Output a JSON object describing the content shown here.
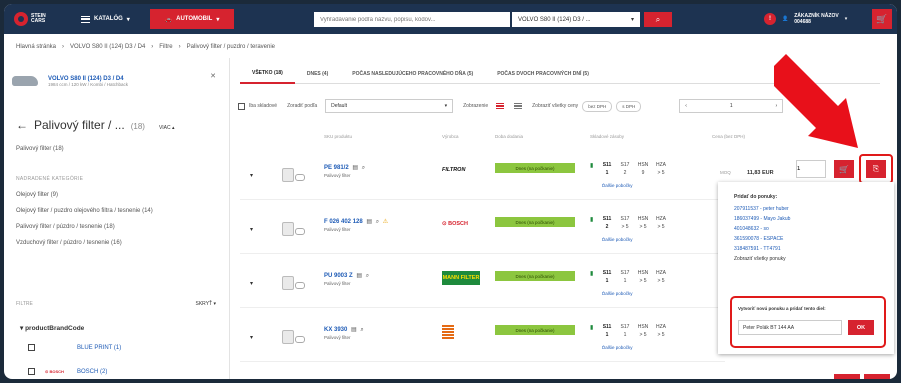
{
  "header": {
    "logo_line1": "STEIN",
    "logo_line2": "CARS",
    "catalog": "KATALÓG",
    "automobil": "AUTOMOBIL",
    "search_placeholder": "Vyhľadávanie podľa názvu, popisu, kódov...",
    "vehicle": "VOLVO S80 II (124) D3 / ...",
    "user_line1": "ZÁKAZNÍK NÁZOV",
    "user_line2": "004688",
    "badge": "!"
  },
  "breadcrumb": [
    "Hlavná stránka",
    "VOLVO S80 II (124) D3 / D4",
    "Filtre",
    "Palivový filter / puzdro / teravenie"
  ],
  "vehicle": {
    "name": "VOLVO S80 II (124) D3 / D4",
    "sub": "1984 ccm / 120 kW / Kombi / Hatchback"
  },
  "category": {
    "title": "Palivový filter / ...",
    "count": "(18)",
    "more": "VIAC",
    "sub": "Palivový filter (18)"
  },
  "related": {
    "head": "NADRADENÉ KATEGÓRIE",
    "items": [
      "Olejový filter (9)",
      "Olejový filter / puzdro olejového filtra / tesnenie (14)",
      "Palivový filter / púzdro / tesnenie (18)",
      "Vzduchový filter / púzdro / tesnenie (16)"
    ]
  },
  "filters": {
    "head": "FILTRE",
    "hide": "SKRYŤ",
    "group": "productBrandCode",
    "brands": [
      "BLUE PRINT (1)",
      "BOSCH (2)"
    ]
  },
  "tabs": [
    "VŠETKO (18)",
    "DNES (4)",
    "POČAS NASLEDUJÚCEHO PRACOVNÉHO DŇA (5)",
    "POČAS DVOCH PRACOVNÝCH DNÍ (5)"
  ],
  "toolbar": {
    "only_stock": "Iba skladové",
    "sort_label": "Zoradiť podľa",
    "sort_value": "Default",
    "view_label": "Zobrazenie",
    "show_all": "Zobraziť všetky ceny",
    "price_with": "bez DPH",
    "price_without": "s DPH",
    "page": "1"
  },
  "columns": {
    "code": "SKU produktu",
    "brand": "Výrobca",
    "delivery": "Doba dodania",
    "stock": "Skladové zásoby",
    "price": "Cena (bez DPH)"
  },
  "products": [
    {
      "code": "PE 981/2",
      "desc": "Palivový filter",
      "brand": "FILTRON",
      "avail": "Dnes (na počkanie)",
      "stock_head": [
        "S11",
        "S17",
        "HSN",
        "HZA"
      ],
      "stock_vals": [
        "1",
        "2",
        "9",
        "> 5"
      ]
    },
    {
      "code": "F 026 402 128",
      "desc": "Palivový filter",
      "brand": "BOSCH",
      "avail": "Dnes (na počkanie)",
      "stock_head": [
        "S11",
        "S17",
        "HSN",
        "HZA"
      ],
      "stock_vals": [
        "2",
        "> 5",
        "> 5",
        "> 5"
      ]
    },
    {
      "code": "PU 9003 Z",
      "desc": "Palivový filter",
      "brand": "MANN FILTER",
      "avail": "Dnes (na počkanie)",
      "stock_head": [
        "S11",
        "S17",
        "HSN",
        "HZA"
      ],
      "stock_vals": [
        "1",
        "1",
        "> 5",
        "> 5"
      ]
    },
    {
      "code": "KX 3930",
      "desc": "Palivový filter",
      "brand": "SOFIMA",
      "avail": "Dnes (na počkanie)",
      "stock_head": [
        "S11",
        "S17",
        "HSN",
        "HZA"
      ],
      "stock_vals": [
        "1",
        "1",
        "> 5",
        "> 5"
      ]
    }
  ],
  "more_stock": "Ďalšie pobočky",
  "first_row": {
    "moq": "MOQ",
    "price": "11,83 EUR",
    "qty": "1"
  },
  "popup": {
    "title": "Pridať do ponuky:",
    "offers": [
      "207911537 - peter huber",
      "186037499 - Mayo Jakub",
      "401048632 - so",
      "361590078 - ESPACE",
      "318487591 - TT4791"
    ],
    "show_all": "Zobraziť všetky ponuky",
    "new_title": "Vytvoriť novú ponuku a pridať tento diel:",
    "new_value": "Peter Polák BT 144 AA",
    "ok": "OK"
  },
  "colors": {
    "brand_red": "#d6232f",
    "nav_blue": "#1d3351",
    "link_blue": "#1e5bb6",
    "avail_green": "#8cc63f"
  }
}
